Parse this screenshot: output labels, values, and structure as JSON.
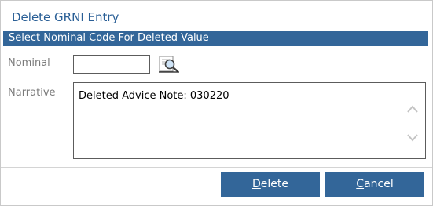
{
  "dialog": {
    "title": "Delete GRNI Entry",
    "section_title": "Select Nominal Code For Deleted Value"
  },
  "form": {
    "nominal_label": "Nominal",
    "nominal_value": "",
    "narrative_label": "Narrative",
    "narrative_value": "Deleted Advice Note: 030220"
  },
  "buttons": {
    "delete_access_key": "D",
    "delete_rest": "elete",
    "cancel_access_key": "C",
    "cancel_rest": "ancel"
  },
  "colors": {
    "accent": "#336699",
    "title_text": "#2a5f96",
    "label_text": "#7a7a7a"
  },
  "icons": {
    "lookup": "magnifier-lookup-icon",
    "scroll_up": "chevron-up-icon",
    "scroll_down": "chevron-down-icon"
  }
}
